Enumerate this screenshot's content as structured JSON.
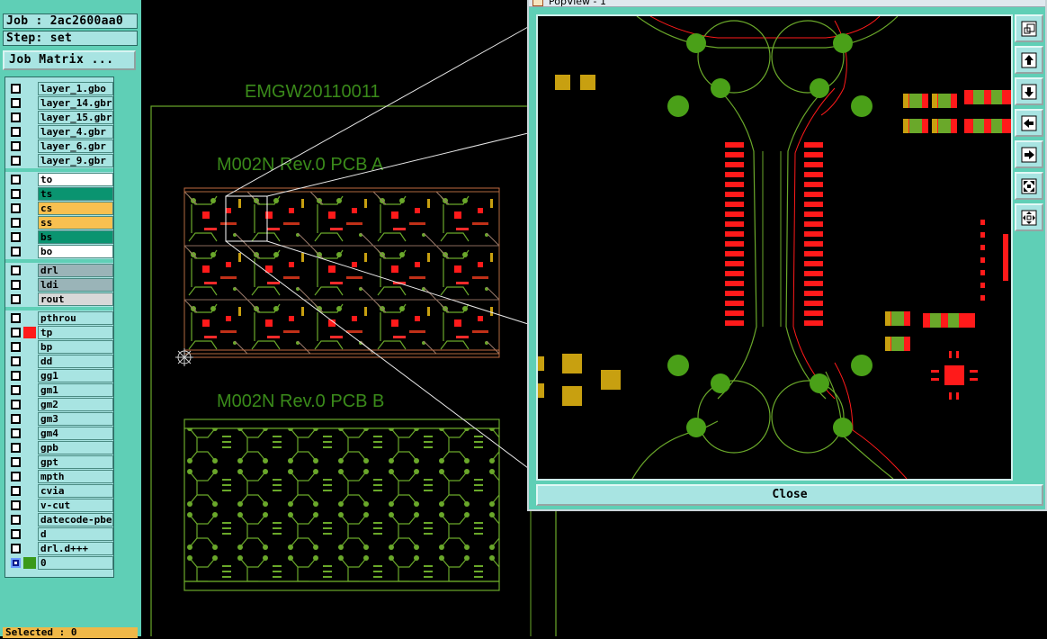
{
  "job": {
    "job_label": "Job : 2ac2600aa0",
    "step_label": "Step: set",
    "matrix_button": "Job Matrix ..."
  },
  "layers": {
    "group1": [
      {
        "name": "layer_1.gbo"
      },
      {
        "name": "layer_14.gbr"
      },
      {
        "name": "layer_15.gbr"
      },
      {
        "name": "layer_4.gbr"
      },
      {
        "name": "layer_6.gbr"
      },
      {
        "name": "layer_9.gbr"
      }
    ],
    "group2": [
      {
        "name": "to",
        "color": "#ffffff"
      },
      {
        "name": "ts",
        "color": "#0a9470"
      },
      {
        "name": "cs",
        "color": "#f8c050"
      },
      {
        "name": "ss",
        "color": "#f8c050"
      },
      {
        "name": "bs",
        "color": "#0a9470"
      },
      {
        "name": "bo",
        "color": "#ffffff"
      }
    ],
    "group3": [
      {
        "name": "drl"
      },
      {
        "name": "ldi"
      },
      {
        "name": "rout"
      }
    ],
    "group4": [
      {
        "name": "pthrou"
      },
      {
        "name": "tp"
      },
      {
        "name": "bp"
      },
      {
        "name": "dd"
      },
      {
        "name": "gg1"
      },
      {
        "name": "gm1"
      },
      {
        "name": "gm2"
      },
      {
        "name": "gm3"
      },
      {
        "name": "gm4"
      },
      {
        "name": "gpb"
      },
      {
        "name": "gpt"
      },
      {
        "name": "mpth"
      },
      {
        "name": "cvia"
      },
      {
        "name": "v-cut"
      },
      {
        "name": "datecode-pbe"
      },
      {
        "name": "d"
      },
      {
        "name": "drl.d+++"
      },
      {
        "name": "0"
      }
    ]
  },
  "status": {
    "selected": "Selected : 0"
  },
  "canvas": {
    "panel_title": "EMGW20110011",
    "pcb_a_label": "M002N Rev.0 PCB A",
    "pcb_b_label": "M002N Rev.0 PCB B"
  },
  "popup": {
    "title": "PopView - 1",
    "close_label": "Close"
  },
  "colors": {
    "panel_bg": "#5fcfb6",
    "field_bg": "#a8e4e2",
    "trace_green": "#6aa82a",
    "pad_red": "#ff1a1a",
    "gold": "#c8a010"
  }
}
